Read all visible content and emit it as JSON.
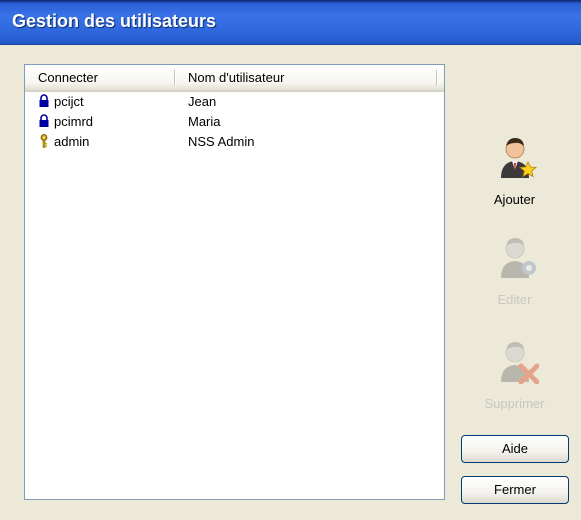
{
  "window": {
    "title": "Gestion des utilisateurs"
  },
  "list": {
    "columns": [
      "Connecter",
      "Nom d'utilisateur"
    ],
    "rows": [
      {
        "login": "pcijct",
        "name": "Jean",
        "icon": "lock-icon"
      },
      {
        "login": "pcimrd",
        "name": "Maria",
        "icon": "lock-icon"
      },
      {
        "login": "admin",
        "name": "NSS Admin",
        "icon": "key-icon"
      }
    ]
  },
  "actions": {
    "add": {
      "label": "Ajouter",
      "icon": "add-user-icon",
      "enabled": true
    },
    "edit": {
      "label": "Editer",
      "icon": "edit-user-icon",
      "enabled": false
    },
    "delete": {
      "label": "Supprimer",
      "icon": "delete-user-icon",
      "enabled": false
    }
  },
  "buttons": {
    "help": "Aide",
    "close": "Fermer"
  },
  "colors": {
    "titlebar": "#2f68dc",
    "window_bg": "#ece9d8",
    "lock": "#0000a0",
    "key": "#c8a000",
    "delete_x": "#e05030"
  }
}
